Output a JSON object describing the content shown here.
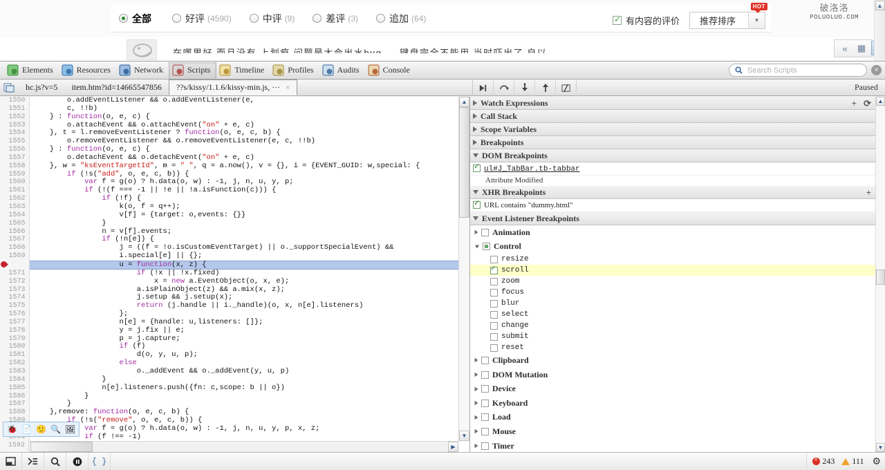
{
  "webpage": {
    "review_filters": [
      {
        "label": "全部",
        "count": "",
        "selected": true
      },
      {
        "label": "好评",
        "count": "(4590)",
        "selected": false
      },
      {
        "label": "中评",
        "count": "(9)",
        "selected": false
      },
      {
        "label": "差评",
        "count": "(3)",
        "selected": false
      },
      {
        "label": "追加",
        "count": "(64)",
        "selected": false
      }
    ],
    "content_checkbox_label": "有内容的评价",
    "sort_select_value": "推荐排序",
    "hot_badge": "HOT",
    "watermark_cn": "破洛洛",
    "watermark_en": "POLUOLUO.COM",
    "review_snippet": "在哪里好  而且没有  上划痕  问题是太会出水bug.... 键盘完全不能用  当时吓出了  自以",
    "mini_toolbar_icons": [
      "collapse-icon",
      "grid-icon",
      "chevron-down-icon"
    ]
  },
  "devtools": {
    "panels": [
      {
        "label": "Elements",
        "icon": "elements-icon",
        "active": false
      },
      {
        "label": "Resources",
        "icon": "resources-icon",
        "active": false
      },
      {
        "label": "Network",
        "icon": "network-icon",
        "active": false
      },
      {
        "label": "Scripts",
        "icon": "scripts-icon",
        "active": true
      },
      {
        "label": "Timeline",
        "icon": "timeline-icon",
        "active": false
      },
      {
        "label": "Profiles",
        "icon": "profiles-icon",
        "active": false
      },
      {
        "label": "Audits",
        "icon": "audits-icon",
        "active": false
      },
      {
        "label": "Console",
        "icon": "console-icon",
        "active": false
      }
    ],
    "search": {
      "placeholder": "Search Scripts",
      "value": ""
    },
    "close_label": "×",
    "file_tabs": [
      {
        "label": "hc.js?v=5",
        "active": false
      },
      {
        "label": "item.htm?id=14665547856",
        "active": false
      },
      {
        "label": "??s/kissy/1.1.6/kissy-min.js, ···",
        "active": true
      }
    ],
    "debug_buttons": [
      {
        "name": "resume-button",
        "glyph": "▶|"
      },
      {
        "name": "step-over-button",
        "glyph": "↷"
      },
      {
        "name": "step-into-button",
        "glyph": "↓"
      },
      {
        "name": "step-out-button",
        "glyph": "↑"
      },
      {
        "name": "toggle-breakpoints-button",
        "glyph": "◩"
      }
    ],
    "status_text": "Paused",
    "status_bar": {
      "buttons": [
        "dock-icon",
        "console-prompt-icon",
        "search-icon",
        "pause-icon",
        "pretty-print-icon"
      ],
      "errors": "243",
      "warnings": "111",
      "settings_icon": "gear-icon"
    },
    "float_toolbar_icons": [
      "bug-icon",
      "page-icon",
      "smiley-icon",
      "inspect-icon",
      "image-icon"
    ],
    "editor": {
      "first_line": 1550,
      "current_line": 1570,
      "breakpoint_line": 1570,
      "last_gutter_line": 1592,
      "lines": [
        {
          "n": 1550,
          "text": "        o.addEventListener && o.addEventListener(e,"
        },
        {
          "n": 1551,
          "text": "        c, !!b)"
        },
        {
          "n": 1552,
          "text": "    } : function(o, e, c) {"
        },
        {
          "n": 1553,
          "text": "        o.attachEvent && o.attachEvent(\"on\" + e, c)"
        },
        {
          "n": 1554,
          "text": "    }, t = l.removeEventListener ? function(o, e, c, b) {"
        },
        {
          "n": 1555,
          "text": "        o.removeEventListener && o.removeEventListener(e, c, !!b)"
        },
        {
          "n": 1556,
          "text": "    } : function(o, e, c) {"
        },
        {
          "n": 1557,
          "text": "        o.detachEvent && o.detachEvent(\"on\" + e, c)"
        },
        {
          "n": 1558,
          "text": "    }, w = \"ksEventTargetId\", m = \" \", q = a.now(), v = {}, i = {EVENT_GUID: w,special: {"
        },
        {
          "n": 1559,
          "text": "        if (!s(\"add\", o, e, c, b)) {"
        },
        {
          "n": 1560,
          "text": "            var f = g(o) ? h.data(o, w) : -1, j, n, u, y, p;"
        },
        {
          "n": 1561,
          "text": "            if (!(f === -1 || !e || !a.isFunction(c))) {"
        },
        {
          "n": 1562,
          "text": "                if (!f) {"
        },
        {
          "n": 1563,
          "text": "                    k(o, f = q++);"
        },
        {
          "n": 1564,
          "text": "                    v[f] = {target: o,events: {}}"
        },
        {
          "n": 1565,
          "text": "                }"
        },
        {
          "n": 1566,
          "text": "                n = v[f].events;"
        },
        {
          "n": 1567,
          "text": "                if (!n[e]) {"
        },
        {
          "n": 1568,
          "text": "                    j = ((f = !o.isCustomEventTarget) || o._supportSpecialEvent) &&"
        },
        {
          "n": 1569,
          "text": "                    i.special[e] || {};"
        },
        {
          "n": 1570,
          "text": "                    u = function(x, z) {"
        },
        {
          "n": 1571,
          "text": "                        if (!x || !x.fixed)"
        },
        {
          "n": 1572,
          "text": "                            x = new a.EventObject(o, x, e);"
        },
        {
          "n": 1573,
          "text": "                        a.isPlainObject(z) && a.mix(x, z);"
        },
        {
          "n": 1574,
          "text": "                        j.setup && j.setup(x);"
        },
        {
          "n": 1575,
          "text": "                        return (j.handle || i._handle)(o, x, n[e].listeners)"
        },
        {
          "n": 1576,
          "text": "                    };"
        },
        {
          "n": 1577,
          "text": "                    n[e] = {handle: u,listeners: []};"
        },
        {
          "n": 1578,
          "text": "                    y = j.fix || e;"
        },
        {
          "n": 1579,
          "text": "                    p = j.capture;"
        },
        {
          "n": 1580,
          "text": "                    if (f)"
        },
        {
          "n": 1581,
          "text": "                        d(o, y, u, p);"
        },
        {
          "n": 1582,
          "text": "                    else"
        },
        {
          "n": 1583,
          "text": "                        o._addEvent && o._addEvent(y, u, p)"
        },
        {
          "n": 1584,
          "text": "                }"
        },
        {
          "n": 1585,
          "text": "                n[e].listeners.push({fn: c,scope: b || o})"
        },
        {
          "n": 1586,
          "text": "            }"
        },
        {
          "n": 1587,
          "text": "        }"
        },
        {
          "n": 1588,
          "text": "    },remove: function(o, e, c, b) {"
        },
        {
          "n": 1589,
          "text": "        if (!s(\"remove\", o, e, c, b)) {"
        },
        {
          "n": 1590,
          "text": "            var f = g(o) ? h.data(o, w) : -1, j, n, u, y, p, x, z;"
        },
        {
          "n": 1591,
          "text": "            if (f !== -1)"
        }
      ]
    },
    "sidebar": {
      "sections": [
        {
          "name": "watch-expressions",
          "label": "Watch Expressions",
          "open": false,
          "actions": [
            "add-icon",
            "refresh-icon"
          ]
        },
        {
          "name": "call-stack",
          "label": "Call Stack",
          "open": false
        },
        {
          "name": "scope-variables",
          "label": "Scope Variables",
          "open": false
        },
        {
          "name": "breakpoints",
          "label": "Breakpoints",
          "open": false
        },
        {
          "name": "dom-breakpoints",
          "label": "DOM Breakpoints",
          "open": true
        },
        {
          "name": "xhr-breakpoints",
          "label": "XHR Breakpoints",
          "open": true,
          "actions": [
            "add-icon"
          ]
        },
        {
          "name": "event-listener-breakpoints",
          "label": "Event Listener Breakpoints",
          "open": true
        }
      ],
      "dom_breakpoint": {
        "selector": "ul#J_TabBar.tb-tabbar",
        "type": "Attribute Modified",
        "checked": true
      },
      "xhr_breakpoint": {
        "label": "URL contains \"dummy.html\"",
        "checked": true
      },
      "event_categories": [
        {
          "label": "Animation",
          "state": "unchecked",
          "open": false,
          "children": []
        },
        {
          "label": "Control",
          "state": "partial",
          "open": true,
          "children": [
            {
              "label": "resize",
              "checked": false,
              "selected": false
            },
            {
              "label": "scroll",
              "checked": true,
              "selected": true
            },
            {
              "label": "zoom",
              "checked": false,
              "selected": false
            },
            {
              "label": "focus",
              "checked": false,
              "selected": false
            },
            {
              "label": "blur",
              "checked": false,
              "selected": false
            },
            {
              "label": "select",
              "checked": false,
              "selected": false
            },
            {
              "label": "change",
              "checked": false,
              "selected": false
            },
            {
              "label": "submit",
              "checked": false,
              "selected": false
            },
            {
              "label": "reset",
              "checked": false,
              "selected": false
            }
          ]
        },
        {
          "label": "Clipboard",
          "state": "unchecked",
          "open": false,
          "children": []
        },
        {
          "label": "DOM Mutation",
          "state": "unchecked",
          "open": false,
          "children": []
        },
        {
          "label": "Device",
          "state": "unchecked",
          "open": false,
          "children": []
        },
        {
          "label": "Keyboard",
          "state": "unchecked",
          "open": false,
          "children": []
        },
        {
          "label": "Load",
          "state": "unchecked",
          "open": false,
          "children": []
        },
        {
          "label": "Mouse",
          "state": "unchecked",
          "open": false,
          "children": []
        },
        {
          "label": "Timer",
          "state": "unchecked",
          "open": false,
          "children": []
        }
      ]
    }
  }
}
